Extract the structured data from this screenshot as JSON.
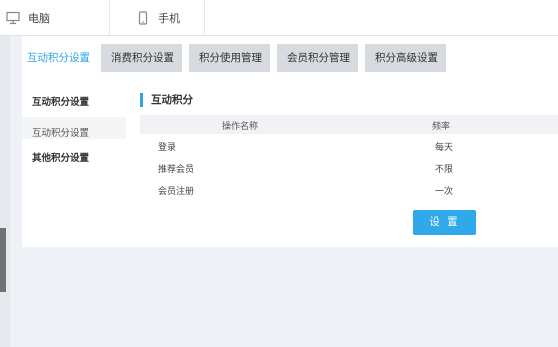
{
  "device_tabs": [
    {
      "label": "电脑",
      "icon": "monitor-icon"
    },
    {
      "label": "手机",
      "icon": "phone-icon"
    }
  ],
  "tabs": [
    {
      "label": "互动积分设置",
      "active": true
    },
    {
      "label": "消费积分设置",
      "active": false
    },
    {
      "label": "积分使用管理",
      "active": false
    },
    {
      "label": "会员积分管理",
      "active": false
    },
    {
      "label": "积分高级设置",
      "active": false
    }
  ],
  "sidebar": {
    "heading": "互动积分设置",
    "items": [
      "互动积分设置",
      "其他积分设置"
    ]
  },
  "section": {
    "title": "互动积分",
    "columns": [
      "操作名称",
      "频率"
    ],
    "rows": [
      {
        "name": "登录",
        "freq": "每天"
      },
      {
        "name": "推荐会员",
        "freq": "不限"
      },
      {
        "name": "会员注册",
        "freq": "一次"
      }
    ]
  },
  "save_button": "设 置",
  "colors": {
    "accent": "#2aa6e8",
    "button": "#2fa9ea",
    "tab_inactive": "#d7dade"
  }
}
